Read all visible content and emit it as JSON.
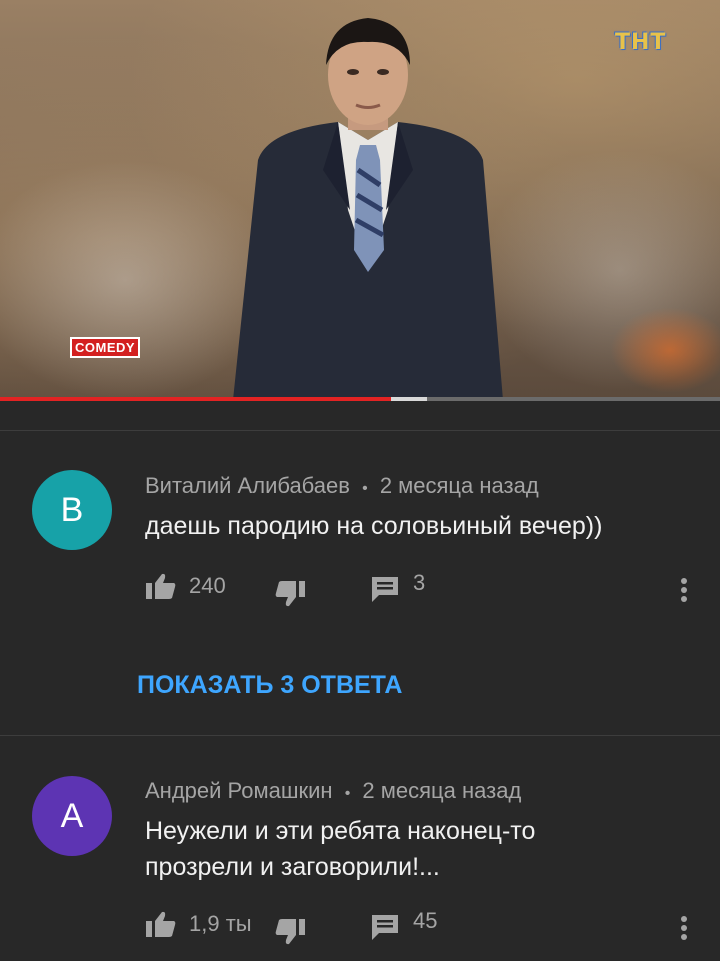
{
  "video": {
    "channel_logo": "ТНТ",
    "show_logo": "COMEDY",
    "progress": {
      "played": 0.543,
      "buffered": 0.593
    }
  },
  "comments": [
    {
      "avatar_letter": "В",
      "avatar_color": "#17a2a8",
      "author": "Виталий Алибабаев",
      "separator": "•",
      "time": "2 месяца назад",
      "text": "даешь пародию на соловьиный вечер))",
      "likes": "240",
      "replies": "3"
    },
    {
      "avatar_letter": "А",
      "avatar_color": "#5d34b3",
      "author": "Андрей Ромашкин",
      "separator": "•",
      "time": "2 месяца назад",
      "text": "Неужели и эти ребята наконец-то прозрели и заговорили!...",
      "likes": "1,9 ты",
      "replies": "45"
    }
  ],
  "show_replies_label": "ПОКАЗАТЬ 3 ОТВЕТА",
  "icons": {
    "like": "thumb-up-icon",
    "dislike": "thumb-down-icon",
    "reply": "comment-icon",
    "more": "more-vert-icon"
  }
}
